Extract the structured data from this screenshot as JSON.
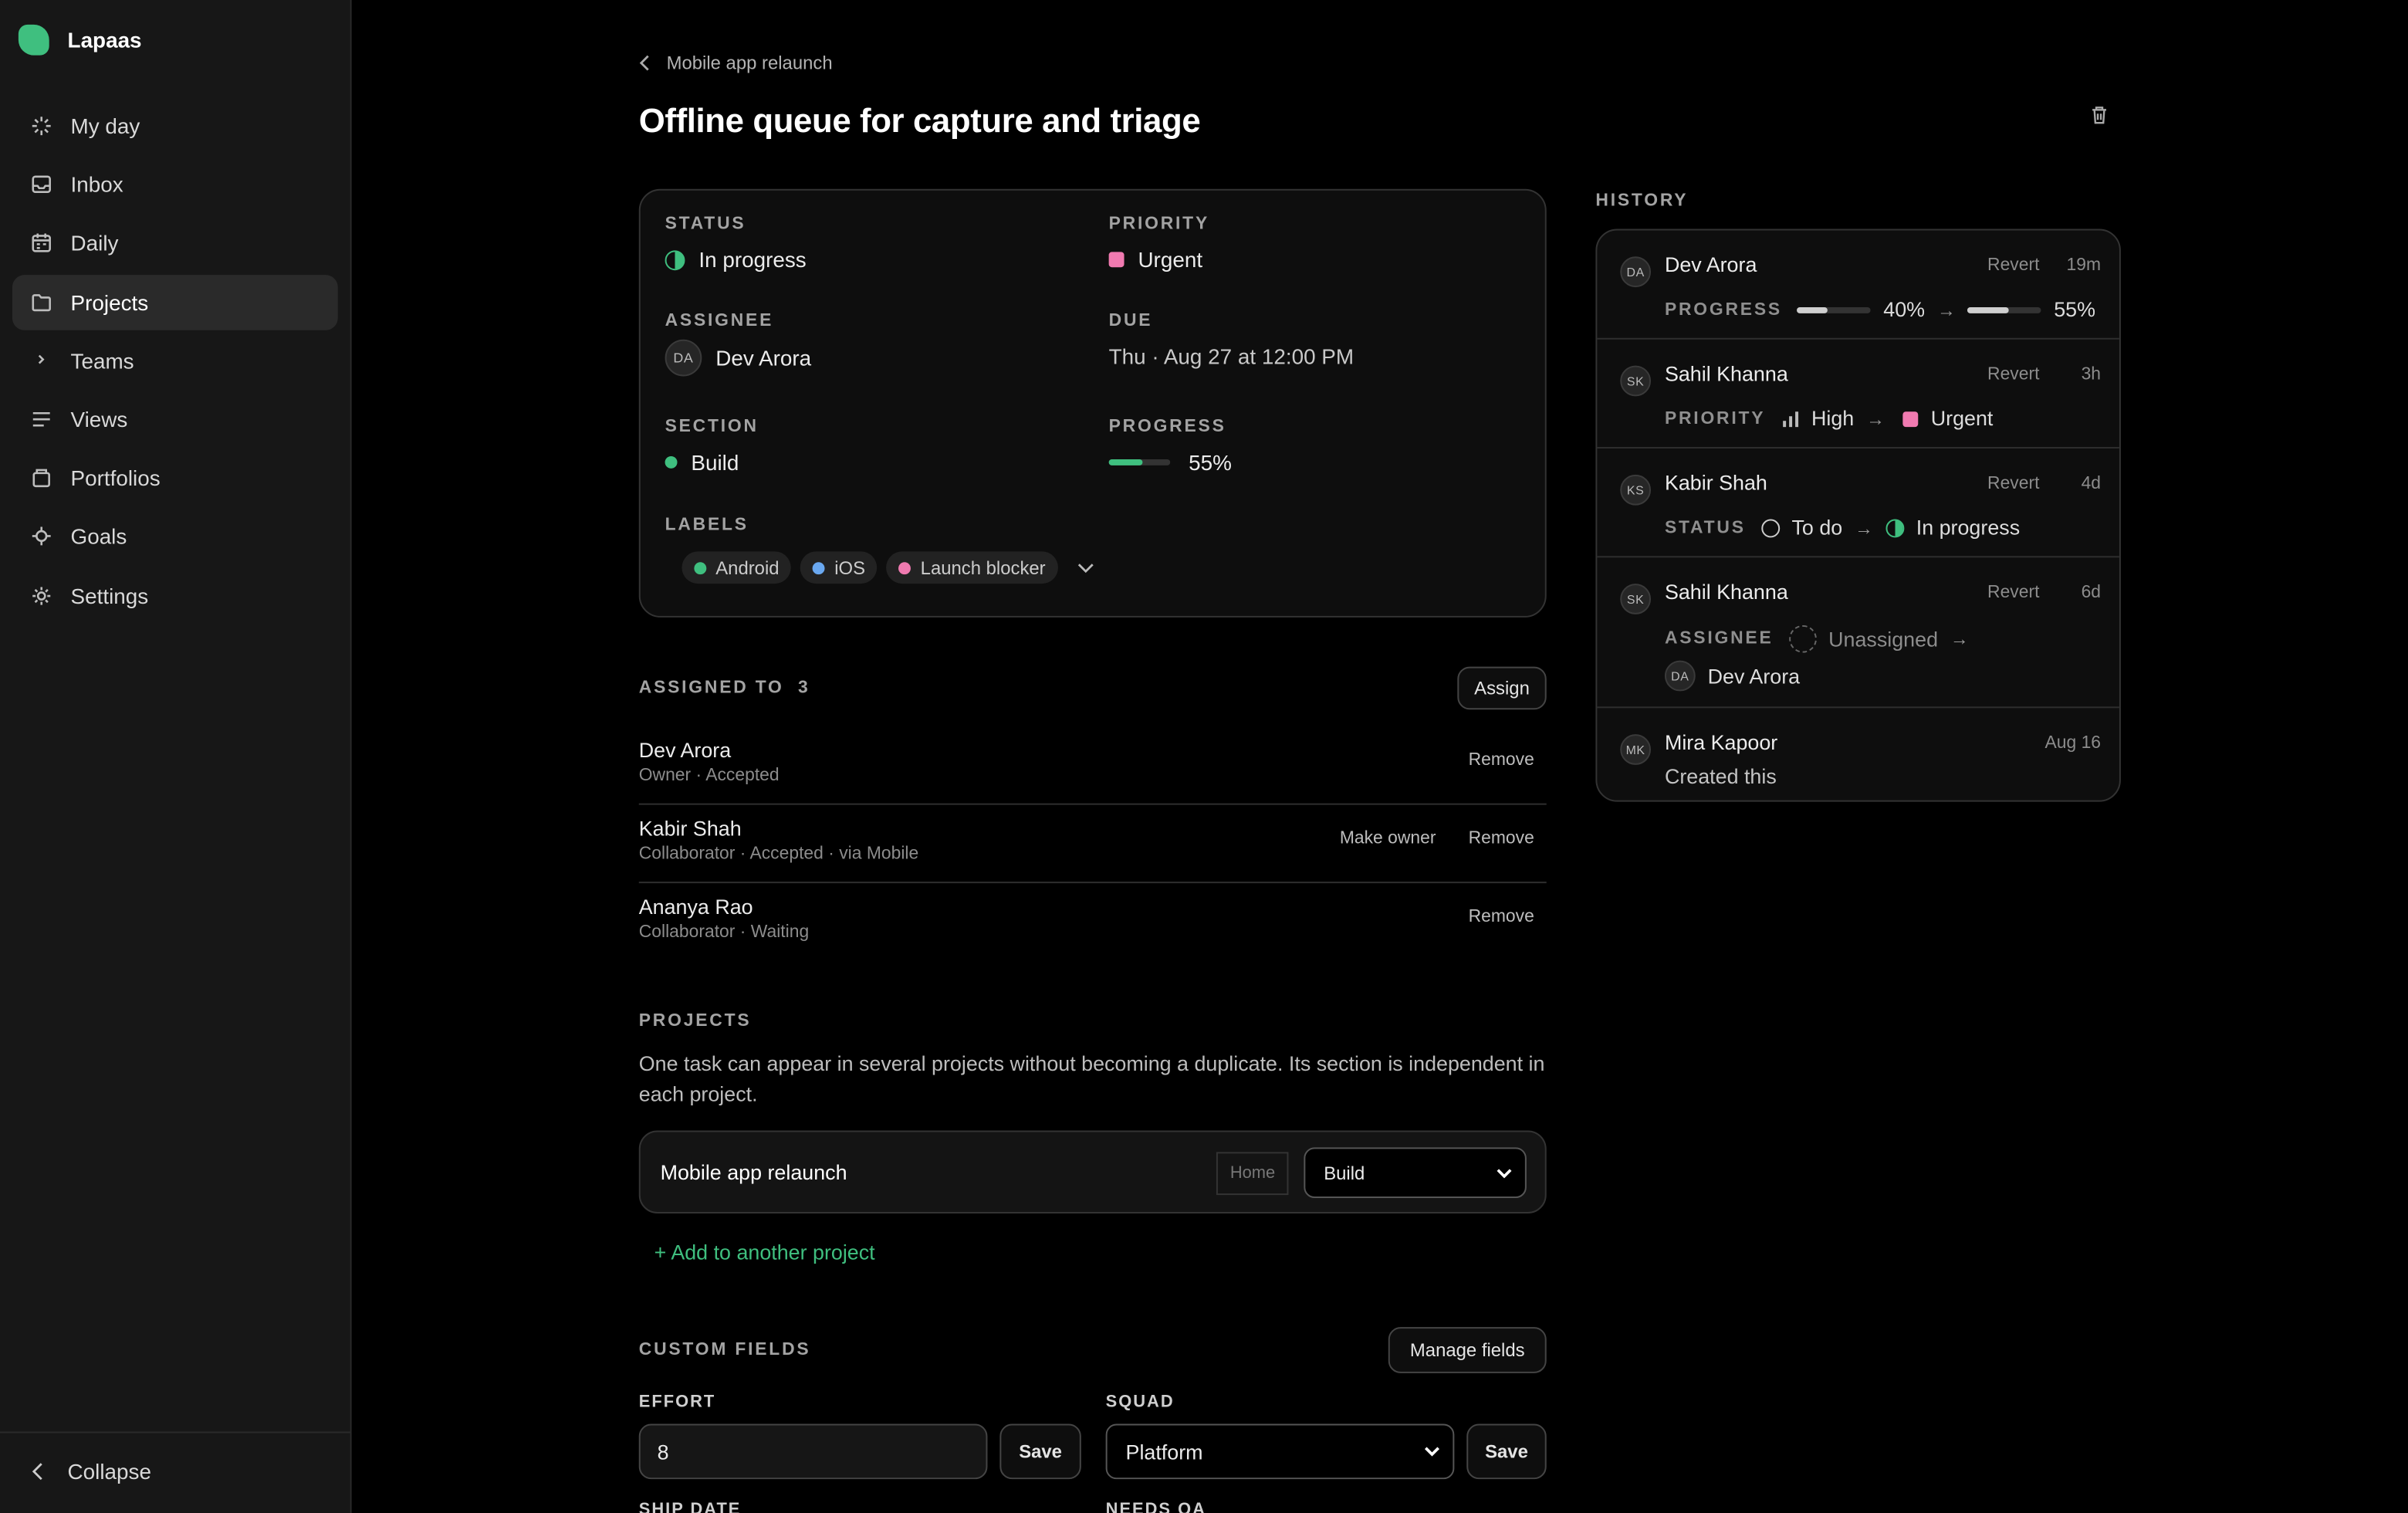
{
  "app": {
    "name": "Lapaas"
  },
  "sidebar": {
    "items": [
      {
        "label": "My day",
        "icon": "sparkle-icon"
      },
      {
        "label": "Inbox",
        "icon": "inbox-icon"
      },
      {
        "label": "Daily",
        "icon": "calendar-icon"
      },
      {
        "label": "Projects",
        "icon": "folder-icon",
        "active": true
      },
      {
        "label": "Teams",
        "icon": "chevron-right-icon"
      },
      {
        "label": "Views",
        "icon": "list-icon"
      },
      {
        "label": "Portfolios",
        "icon": "briefcase-icon"
      },
      {
        "label": "Goals",
        "icon": "target-icon"
      },
      {
        "label": "Settings",
        "icon": "gear-icon"
      }
    ],
    "collapse_label": "Collapse"
  },
  "task": {
    "breadcrumb": "Mobile app relaunch",
    "title": "Offline queue for capture and triage",
    "status_label": "STATUS",
    "status": "In progress",
    "priority_label": "PRIORITY",
    "priority": "Urgent",
    "assignee_label": "ASSIGNEE",
    "assignee": "Dev Arora",
    "assignee_initials": "DA",
    "due_label": "DUE",
    "due": "Thu · Aug 27 at 12:00 PM",
    "section_label": "SECTION",
    "section": "Build",
    "progress_label": "PROGRESS",
    "progress_text": "55%",
    "progress": 0.55,
    "labels_label": "LABELS",
    "labels": [
      {
        "name": "Android",
        "color": "#3fbf7f"
      },
      {
        "name": "iOS",
        "color": "#6aa8f0"
      },
      {
        "name": "Launch blocker",
        "color": "#f07ab0"
      }
    ]
  },
  "colors": {
    "accent": "#3fbf7f",
    "urgent": "#f07ab0"
  },
  "assigned": {
    "title": "ASSIGNED TO",
    "count": "3",
    "assign_button": "Assign",
    "rows": [
      {
        "name": "Dev Arora",
        "sub": "Owner · Accepted",
        "remove": "Remove"
      },
      {
        "name": "Kabir Shah",
        "sub": "Collaborator · Accepted · via Mobile",
        "make_owner": "Make owner",
        "remove": "Remove"
      },
      {
        "name": "Ananya Rao",
        "sub": "Collaborator · Waiting",
        "remove": "Remove"
      }
    ]
  },
  "projects": {
    "title": "PROJECTS",
    "description": "One task can appear in several projects without becoming a duplicate. Its section is independent in each project.",
    "project_name": "Mobile app relaunch",
    "home_tag": "Home",
    "section_value": "Build",
    "add_link": "+ Add to another project"
  },
  "custom_fields": {
    "title": "CUSTOM FIELDS",
    "manage_button": "Manage fields",
    "effort_label": "EFFORT",
    "effort_value": "8",
    "squad_label": "SQUAD",
    "squad_value": "Platform",
    "save_label": "Save",
    "ship_date_label": "SHIP DATE",
    "needs_qa_label": "NEEDS QA"
  },
  "history": {
    "title": "HISTORY",
    "revert": "Revert",
    "entries": [
      {
        "initials": "DA",
        "who": "Dev Arora",
        "ago": "19m",
        "key": "PROGRESS",
        "from": "40%",
        "to": "55%",
        "from_value": 0.4,
        "to_value": 0.55
      },
      {
        "initials": "SK",
        "who": "Sahil Khanna",
        "ago": "3h",
        "key": "PRIORITY",
        "from": "High",
        "to": "Urgent"
      },
      {
        "initials": "KS",
        "who": "Kabir Shah",
        "ago": "4d",
        "key": "STATUS",
        "from": "To do",
        "to": "In progress"
      },
      {
        "initials": "SK",
        "who": "Sahil Khanna",
        "ago": "6d",
        "key": "ASSIGNEE",
        "from": "Unassigned",
        "to": "Dev Arora",
        "to_initials": "DA"
      },
      {
        "initials": "MK",
        "who": "Mira Kapoor",
        "ago": "Aug 16",
        "detail": "Created this"
      }
    ]
  }
}
